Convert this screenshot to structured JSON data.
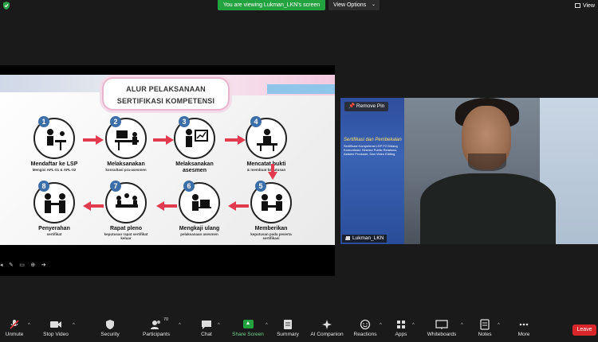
{
  "top": {
    "banner_text": "You are viewing Lukman_LKN's screen",
    "view_options_label": "View Options",
    "view_label": "View"
  },
  "slide": {
    "title_line1": "ALUR PELAKSANAAN",
    "title_line2": "SERTIFIKASI KOMPETENSI",
    "steps": [
      {
        "num": "1",
        "label": "Mendaftar ke LSP",
        "sub": "Mengisi APL-01 & APL-02"
      },
      {
        "num": "2",
        "label": "Melaksanakan",
        "sub": "konsultasi pra-asesmen"
      },
      {
        "num": "3",
        "label": "Melaksanakan asesmen",
        "sub": ""
      },
      {
        "num": "4",
        "label": "Mencatat bukti",
        "sub": "& membuat keputusan"
      },
      {
        "num": "5",
        "label": "Memberikan",
        "sub": "keputusan pada peserta sertifikasi"
      },
      {
        "num": "6",
        "label": "Mengkaji ulang",
        "sub": "pelaksanaan asesmen"
      },
      {
        "num": "7",
        "label": "Rapat pleno",
        "sub": "keputusan rapat sertifikat keluar"
      },
      {
        "num": "8",
        "label": "Penyerahan",
        "sub": "sertifikat"
      }
    ]
  },
  "video": {
    "remove_pin_label": "Remove Pin",
    "participant_name": "Lukman_LKN",
    "poster_title": "Sertifikasi dan Pembekalan",
    "poster_text": "Sertifikasi Kompetensi LSP P2 Bidang Komunikasi: Sinema Public Relations, Asisten Produser, Dan Video Editing"
  },
  "toolbar": {
    "unmute": "Unmute",
    "stop_video": "Stop Video",
    "security": "Security",
    "participants": "Participants",
    "participants_count": "70",
    "chat": "Chat",
    "share_screen": "Share Screen",
    "summary": "Summary",
    "ai_companion": "AI Companion",
    "reactions": "Reactions",
    "apps": "Apps",
    "whiteboards": "Whiteboards",
    "notes": "Notes",
    "more": "More",
    "leave": "Leave"
  },
  "colors": {
    "share_green": "#23a340",
    "leave_red": "#d8262a",
    "step_number_blue": "#3c6ea8",
    "arrow_red": "#e23a4e"
  }
}
